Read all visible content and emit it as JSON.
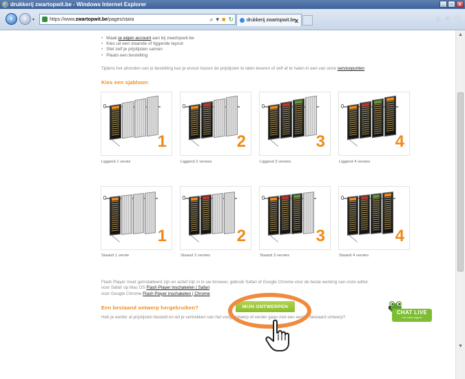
{
  "window": {
    "title": "drukkerij zwartopwit.be - Windows Internet Explorer",
    "buttons": [
      "_",
      "▫",
      "x"
    ]
  },
  "browser": {
    "url_prefix": "https://www.",
    "url_domain": "zwartopwit.be",
    "url_path": "/pages/stara",
    "tab_title": "drukkerij zwartopwit.be",
    "tab_close": "x"
  },
  "intro": {
    "items": [
      {
        "before": "Maak ",
        "link": "je eigen account",
        "after": " aan bij zwartopwit.be"
      },
      {
        "before": "Kies uit een staande of liggende layout",
        "link": "",
        "after": ""
      },
      {
        "before": "Stel zelf je prijslijsten samen",
        "link": "",
        "after": ""
      },
      {
        "before": "Plaats een bestelling",
        "link": "",
        "after": ""
      }
    ],
    "para_text": "Tijdens het afronden van je bestelling kan je ervoor kiezen de prijslijsten te laten leveren of zelf af te halen in een van onze ",
    "para_link": "servicepunten"
  },
  "templates": {
    "heading": "Kies een sjabloon:",
    "liggend": [
      {
        "number": "1",
        "caption": "Liggend 1 versie"
      },
      {
        "number": "2",
        "caption": "Liggend 2 versies"
      },
      {
        "number": "3",
        "caption": "Liggend 3 versies"
      },
      {
        "number": "4",
        "caption": "Liggend 4 versies"
      }
    ],
    "staand": [
      {
        "number": "1",
        "caption": "Staand 1 versie"
      },
      {
        "number": "2",
        "caption": "Staand 2 versies"
      },
      {
        "number": "3",
        "caption": "Staand 3 versies"
      },
      {
        "number": "4",
        "caption": "Staand 4 versies"
      }
    ]
  },
  "flash": {
    "line1": "Flash Player moet geïnstalleerd zijn en actief zijn in in uw browser, gebruik Safari of Google Chrome voor de beste werking van onze editor.",
    "line2_before": "voor Safari op Mac OS ",
    "line2_link": "Flash Player inschakelen | Safari",
    "line3_before": "voor Google Chrome ",
    "line3_link": "Flash Player inschakelen | Chrome"
  },
  "reuse": {
    "heading": "Een bestaand ontwerp hergebruiken?",
    "text": "Heb je eerder al prijslijsten besteld en wil je vertrekken van het vorig ontwerp of verder gaan met een eerder bewaard ontwerp?",
    "button": "MIJN ONTWERPEN"
  },
  "chat": {
    "title": "CHAT LIVE",
    "subtitle": "met onze support"
  },
  "colors": {
    "accent_orange": "#f08a18",
    "button_green": "#8dbb2c",
    "highlight_ring": "#f08a3c"
  }
}
